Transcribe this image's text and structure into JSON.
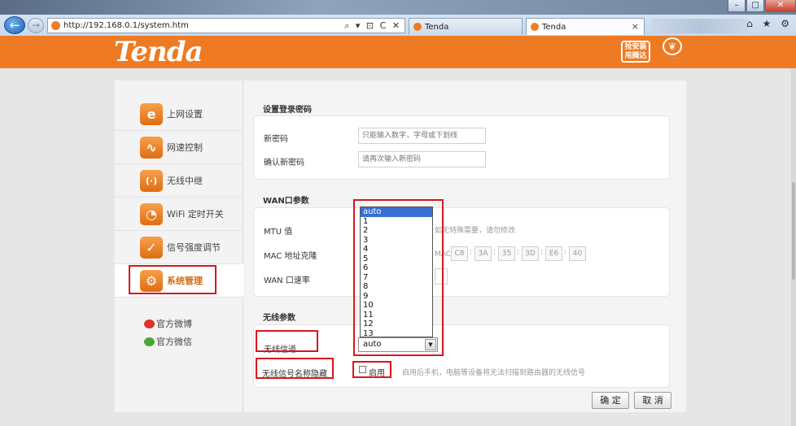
{
  "browser": {
    "url": "http://192.168.0.1/system.htm",
    "address_tools": "⌕ ▾ ⊡ C ✕",
    "tabs": [
      {
        "label": "Tenda"
      },
      {
        "label": "Tenda",
        "close": "×"
      }
    ],
    "window_buttons": [
      "–",
      "□",
      "✕"
    ],
    "right_icons": "⌂ ★ ⚙"
  },
  "header": {
    "logo": "Tenda",
    "badge_text": "抢安装 用腾达",
    "accent_color": "#ee7b24"
  },
  "sidebar": {
    "items": [
      {
        "label": "上网设置",
        "icon": "ie-icon",
        "glyph": "e"
      },
      {
        "label": "网速控制",
        "icon": "speed-wave-icon",
        "glyph": "∿"
      },
      {
        "label": "无线中继",
        "icon": "wireless-relay-icon",
        "glyph": "(·)"
      },
      {
        "label": "WiFi 定时开关",
        "icon": "clock-icon",
        "glyph": "◔"
      },
      {
        "label": "信号强度调节",
        "icon": "signal-adjust-icon",
        "glyph": "✓"
      },
      {
        "label": "系统管理",
        "icon": "gear-icon",
        "glyph": "⚙",
        "active": true
      }
    ],
    "weibo": "官方微博",
    "wechat": "官方微信"
  },
  "password_section": {
    "title": "设置登录密码",
    "new_password_label": "新密码",
    "new_password_placeholder": "只能输入数字，字母或下划线",
    "confirm_label": "确认新密码",
    "confirm_placeholder": "请再次输入新密码"
  },
  "wan_section": {
    "title": "WAN口参数",
    "mtu_label": "MTU 值",
    "mtu_hint": "如无特殊需要，请勿修改",
    "mac_label": "MAC 地址克隆",
    "mac_prefix": "MAC",
    "mac_parts": [
      "C8",
      "3A",
      "35",
      "3D",
      "E6",
      "40"
    ],
    "speed_label": "WAN 口速率"
  },
  "wireless_section": {
    "title": "无线参数",
    "channel_label": "无线信道",
    "channel_value": "auto",
    "channel_options": [
      "auto",
      "1",
      "2",
      "3",
      "4",
      "5",
      "6",
      "7",
      "8",
      "9",
      "10",
      "11",
      "12",
      "13"
    ],
    "hide_ssid_label": "无线信号名称隐藏",
    "enable_label": "启用",
    "hide_hint": "启用后手机，电脑等设备将无法扫描到路由器的无线信号"
  },
  "actions": {
    "ok": "确 定",
    "cancel": "取 消"
  }
}
